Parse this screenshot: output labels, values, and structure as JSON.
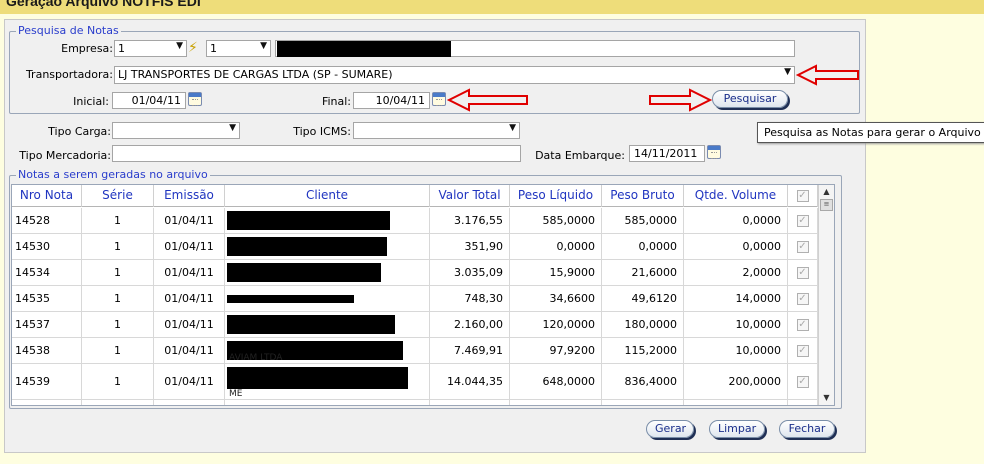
{
  "header": {
    "title": "Geração Arquivo NOTFIS EDI"
  },
  "search": {
    "legend": "Pesquisa de Notas",
    "empresa_label": "Empresa:",
    "empresa_value": "1",
    "filial_value": "1",
    "transportadora_label": "Transportadora:",
    "transportadora_value": "LJ TRANSPORTES DE CARGAS LTDA (SP - SUMARE)",
    "inicial_label": "Inicial:",
    "inicial_value": "01/04/11",
    "final_label": "Final:",
    "final_value": "10/04/11",
    "search_button": "Pesquisar",
    "tooltip": "Pesquisa as Notas para gerar o Arquivo"
  },
  "filters": {
    "tipo_carga_label": "Tipo Carga:",
    "tipo_carga_value": "",
    "tipo_icms_label": "Tipo ICMS:",
    "tipo_icms_value": "",
    "tipo_mercadoria_label": "Tipo Mercadoria:",
    "tipo_mercadoria_value": "",
    "data_embarque_label": "Data Embarque:",
    "data_embarque_value": "14/11/2011"
  },
  "grid": {
    "legend": "Notas a serem geradas no arquivo",
    "columns": [
      "Nro Nota",
      "Série",
      "Emissão",
      "Cliente",
      "Valor Total",
      "Peso Líquido",
      "Peso Bruto",
      "Qtde. Volume"
    ],
    "rows": [
      {
        "nro": "14528",
        "serie": "1",
        "emissao": "01/04/11",
        "cliente_sub": "",
        "valor": "3.176,55",
        "liquido": "585,0000",
        "bruto": "585,0000",
        "volume": "0,0000"
      },
      {
        "nro": "14530",
        "serie": "1",
        "emissao": "01/04/11",
        "cliente_sub": "",
        "valor": "351,90",
        "liquido": "0,0000",
        "bruto": "0,0000",
        "volume": "0,0000"
      },
      {
        "nro": "14534",
        "serie": "1",
        "emissao": "01/04/11",
        "cliente_sub": "",
        "valor": "3.035,09",
        "liquido": "15,9000",
        "bruto": "21,6000",
        "volume": "2,0000"
      },
      {
        "nro": "14535",
        "serie": "1",
        "emissao": "01/04/11",
        "cliente_sub": "",
        "valor": "748,30",
        "liquido": "34,6600",
        "bruto": "49,6120",
        "volume": "14,0000"
      },
      {
        "nro": "14537",
        "serie": "1",
        "emissao": "01/04/11",
        "cliente_sub": "",
        "valor": "2.160,00",
        "liquido": "120,0000",
        "bruto": "180,0000",
        "volume": "10,0000"
      },
      {
        "nro": "14538",
        "serie": "1",
        "emissao": "01/04/11",
        "cliente_sub": "AVIAM LTDA",
        "valor": "7.469,91",
        "liquido": "97,9200",
        "bruto": "115,2000",
        "volume": "10,0000"
      },
      {
        "nro": "14539",
        "serie": "1",
        "emissao": "01/04/11",
        "cliente_sub": "ME",
        "valor": "14.044,35",
        "liquido": "648,0000",
        "bruto": "836,4000",
        "volume": "200,0000"
      }
    ]
  },
  "footer": {
    "gerar": "Gerar",
    "limpar": "Limpar",
    "fechar": "Fechar"
  },
  "colors": {
    "accent": "#2035c0",
    "highlight_arrow": "#e00000",
    "title_bar": "#eedd7a"
  }
}
